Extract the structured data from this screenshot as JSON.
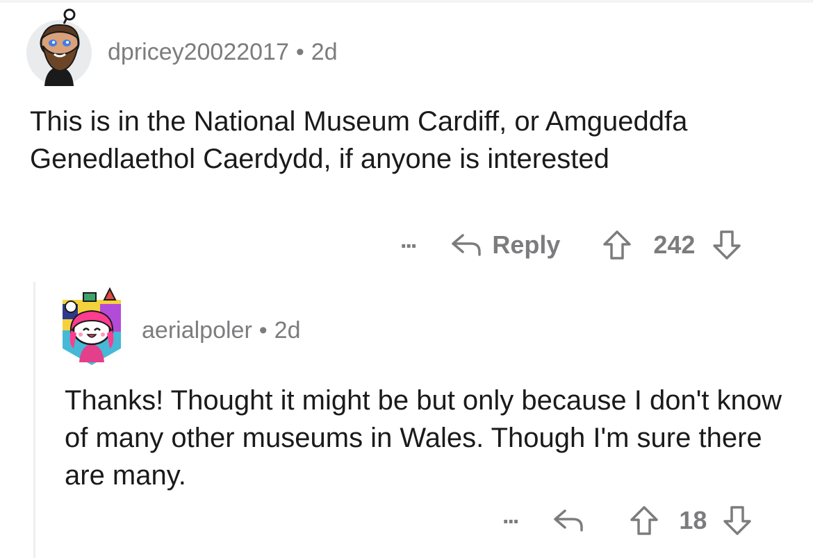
{
  "comments": [
    {
      "username": "dpricey20022017",
      "separator": "•",
      "age": "2d",
      "avatar": "bearded-snoo-avatar",
      "text": "This is in the National Museum Cardiff, or Amgueddfa Genedlaethol Caerdydd, if anyone is interested",
      "more_label": "...",
      "reply_label": "Reply",
      "score": "242"
    },
    {
      "username": "aerialpoler",
      "separator": "•",
      "age": "2d",
      "avatar": "pink-hair-snoo-avatar",
      "text": "Thanks! Thought it might be but only because I don't know of many other museums in Wales. Though I'm sure there are many.",
      "more_label": "...",
      "score": "18"
    }
  ],
  "colors": {
    "meta_text": "#7c7c7e",
    "body_text": "#1a1a1b",
    "thread_line": "#edeff1"
  }
}
